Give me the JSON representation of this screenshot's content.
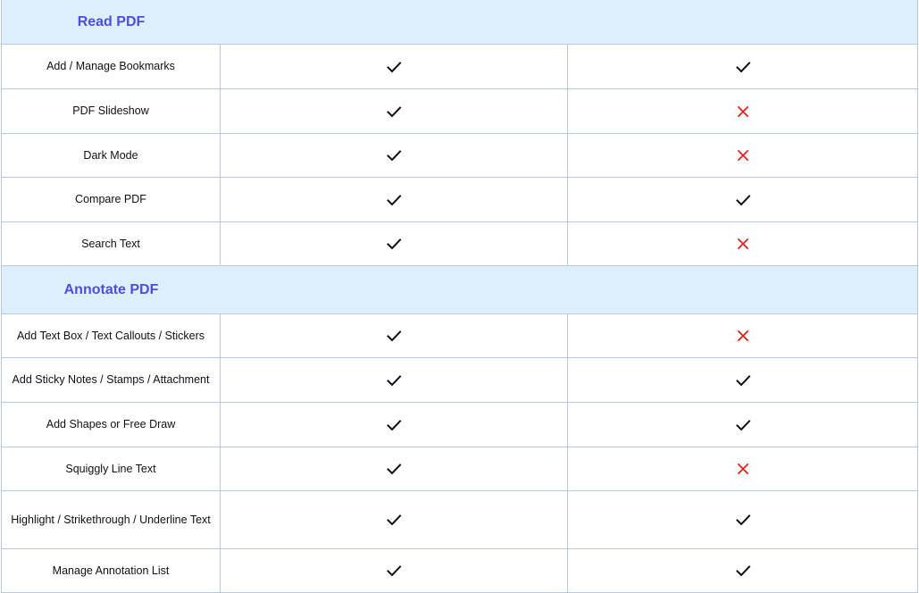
{
  "colors": {
    "section_background": "#ddeefd",
    "section_title": "#4b4fe0",
    "border": "#b7c9e2",
    "check": "#111111",
    "cross": "#e0241b"
  },
  "sections": [
    {
      "title": "Read PDF",
      "rows": [
        {
          "label": "Add / Manage Bookmarks",
          "col_a": "check",
          "col_b": "check"
        },
        {
          "label": "PDF Slideshow",
          "col_a": "check",
          "col_b": "cross"
        },
        {
          "label": "Dark Mode",
          "col_a": "check",
          "col_b": "cross"
        },
        {
          "label": "Compare PDF",
          "col_a": "check",
          "col_b": "check"
        },
        {
          "label": "Search Text",
          "col_a": "check",
          "col_b": "cross"
        }
      ]
    },
    {
      "title": "Annotate PDF",
      "rows": [
        {
          "label": "Add Text Box / Text Callouts / Stickers",
          "col_a": "check",
          "col_b": "cross"
        },
        {
          "label": "Add Sticky Notes / Stamps / Attachment",
          "col_a": "check",
          "col_b": "check"
        },
        {
          "label": "Add Shapes or Free Draw",
          "col_a": "check",
          "col_b": "check"
        },
        {
          "label": "Squiggly Line Text",
          "col_a": "check",
          "col_b": "cross"
        },
        {
          "label": "Highlight / Strikethrough / Underline Text",
          "col_a": "check",
          "col_b": "check"
        },
        {
          "label": "Manage Annotation List",
          "col_a": "check",
          "col_b": "check"
        }
      ]
    }
  ]
}
